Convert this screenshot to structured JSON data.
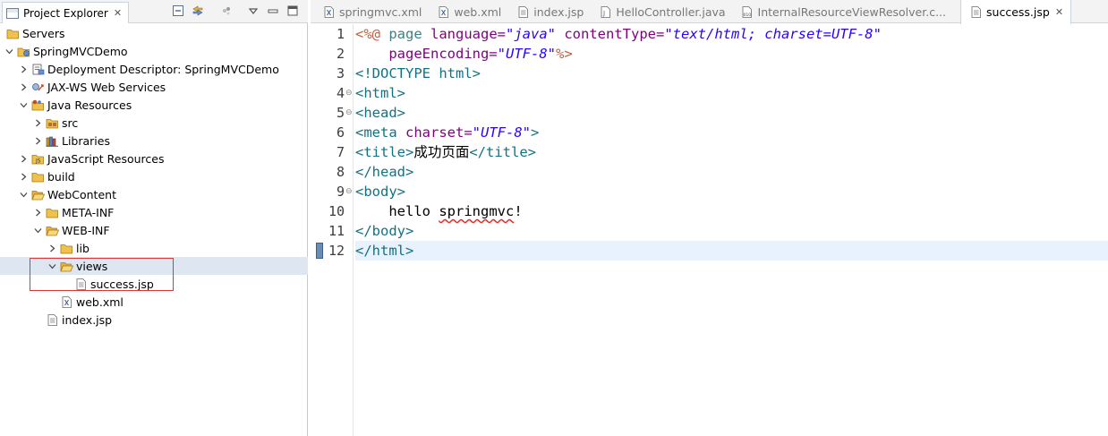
{
  "explorer": {
    "title": "Project Explorer",
    "tree": [
      {
        "label": "Servers",
        "icon": "folder-icon",
        "expand": "none"
      },
      {
        "label": "SpringMVCDemo",
        "icon": "web-project-icon",
        "expand": "expanded"
      },
      {
        "label": "Deployment Descriptor: SpringMVCDemo",
        "icon": "deployment-descriptor-icon",
        "expand": "collapsed"
      },
      {
        "label": "JAX-WS Web Services",
        "icon": "web-services-icon",
        "expand": "collapsed"
      },
      {
        "label": "Java Resources",
        "icon": "java-resources-icon",
        "expand": "expanded"
      },
      {
        "label": "src",
        "icon": "package-folder-icon",
        "expand": "collapsed"
      },
      {
        "label": "Libraries",
        "icon": "libraries-icon",
        "expand": "collapsed"
      },
      {
        "label": "JavaScript Resources",
        "icon": "javascript-resources-icon",
        "expand": "collapsed"
      },
      {
        "label": "build",
        "icon": "folder-icon",
        "expand": "collapsed"
      },
      {
        "label": "WebContent",
        "icon": "folder-open-icon",
        "expand": "expanded"
      },
      {
        "label": "META-INF",
        "icon": "folder-icon",
        "expand": "collapsed"
      },
      {
        "label": "WEB-INF",
        "icon": "folder-open-icon",
        "expand": "expanded"
      },
      {
        "label": "lib",
        "icon": "folder-icon",
        "expand": "collapsed"
      },
      {
        "label": "views",
        "icon": "folder-open-icon",
        "expand": "expanded"
      },
      {
        "label": "success.jsp",
        "icon": "jsp-file-icon",
        "expand": "none"
      },
      {
        "label": "web.xml",
        "icon": "xml-file-icon",
        "expand": "none"
      },
      {
        "label": "index.jsp",
        "icon": "jsp-file-icon",
        "expand": "none"
      }
    ]
  },
  "editor": {
    "tabs": [
      {
        "label": "springmvc.xml",
        "icon": "xml-file-icon"
      },
      {
        "label": "web.xml",
        "icon": "xml-file-icon"
      },
      {
        "label": "index.jsp",
        "icon": "jsp-file-icon"
      },
      {
        "label": "HelloController.java",
        "icon": "java-file-icon"
      },
      {
        "label": "InternalResourceViewResolver.c...",
        "icon": "class-file-icon"
      },
      {
        "label": "success.jsp",
        "icon": "jsp-file-icon",
        "active": true
      }
    ],
    "line_numbers": [
      "1",
      "2",
      "3",
      "4",
      "5",
      "6",
      "7",
      "8",
      "9",
      "10",
      "11",
      "12"
    ],
    "code": {
      "l1_open": "<%@ ",
      "l1_page": "page ",
      "l1_lang_attr": "language=",
      "l1_lang_val": "\"java\"",
      "l1_ct_attr": " contentType=",
      "l1_ct_val": "\"text/html; charset=UTF-8\"",
      "l2_indent": "    ",
      "l2_pe_attr": "pageEncoding=",
      "l2_pe_val": "\"UTF-8\"",
      "l2_close": "%>",
      "l3": "<!DOCTYPE html>",
      "l4": "<html>",
      "l5": "<head>",
      "l6_open": "<meta ",
      "l6_attr": "charset=",
      "l6_val": "\"UTF-8\"",
      "l6_close": ">",
      "l7_open": "<title>",
      "l7_text": "成功页面",
      "l7_close": "</title>",
      "l8": "</head>",
      "l9": "<body>",
      "l10_indent": "    ",
      "l10_hello": "hello ",
      "l10_word": "springmvc",
      "l10_bang": "!",
      "l11": "</body>",
      "l12": "</html>"
    }
  }
}
